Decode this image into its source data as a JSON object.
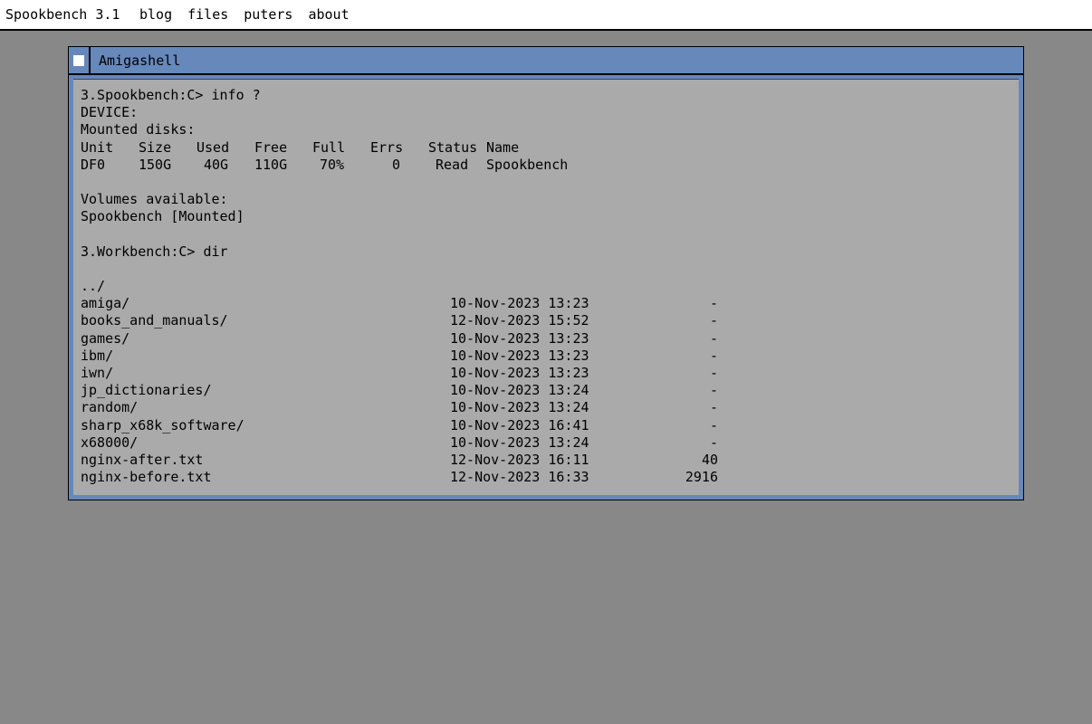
{
  "menubar": {
    "title": "Spookbench 3.1",
    "items": [
      "blog",
      "files",
      "puters",
      "about"
    ]
  },
  "window": {
    "title": "Amigashell"
  },
  "shell": {
    "prompt1": "3.Spookbench:C> info ?",
    "device_line": "DEVICE:",
    "mounted_line": "Mounted disks:",
    "disk_headers": [
      "Unit",
      "Size",
      "Used",
      "Free",
      "Full",
      "Errs",
      "Status",
      "Name"
    ],
    "disk_row": [
      "DF0",
      "150G",
      "40G",
      "110G",
      "70%",
      "0",
      "Read",
      "Spookbench"
    ],
    "volumes_line": "Volumes available:",
    "volume_entry": "Spookbench [Mounted]",
    "prompt2": "3.Workbench:C> dir",
    "parent_dir": "../",
    "entries": [
      {
        "name": "amiga/",
        "date": "10-Nov-2023 13:23",
        "size": "-"
      },
      {
        "name": "books_and_manuals/",
        "date": "12-Nov-2023 15:52",
        "size": "-"
      },
      {
        "name": "games/",
        "date": "10-Nov-2023 13:23",
        "size": "-"
      },
      {
        "name": "ibm/",
        "date": "10-Nov-2023 13:23",
        "size": "-"
      },
      {
        "name": "iwn/",
        "date": "10-Nov-2023 13:23",
        "size": "-"
      },
      {
        "name": "jp_dictionaries/",
        "date": "10-Nov-2023 13:24",
        "size": "-"
      },
      {
        "name": "random/",
        "date": "10-Nov-2023 13:24",
        "size": "-"
      },
      {
        "name": "sharp_x68k_software/",
        "date": "10-Nov-2023 16:41",
        "size": "-"
      },
      {
        "name": "x68000/",
        "date": "10-Nov-2023 13:24",
        "size": "-"
      },
      {
        "name": "nginx-after.txt",
        "date": "12-Nov-2023 16:11",
        "size": "40"
      },
      {
        "name": "nginx-before.txt",
        "date": "12-Nov-2023 16:33",
        "size": "2916"
      }
    ]
  },
  "colors": {
    "desktop": "#888888",
    "window_frame": "#6688bb",
    "shell_bg": "#aaaaaa",
    "menubar_bg": "#ffffff"
  }
}
